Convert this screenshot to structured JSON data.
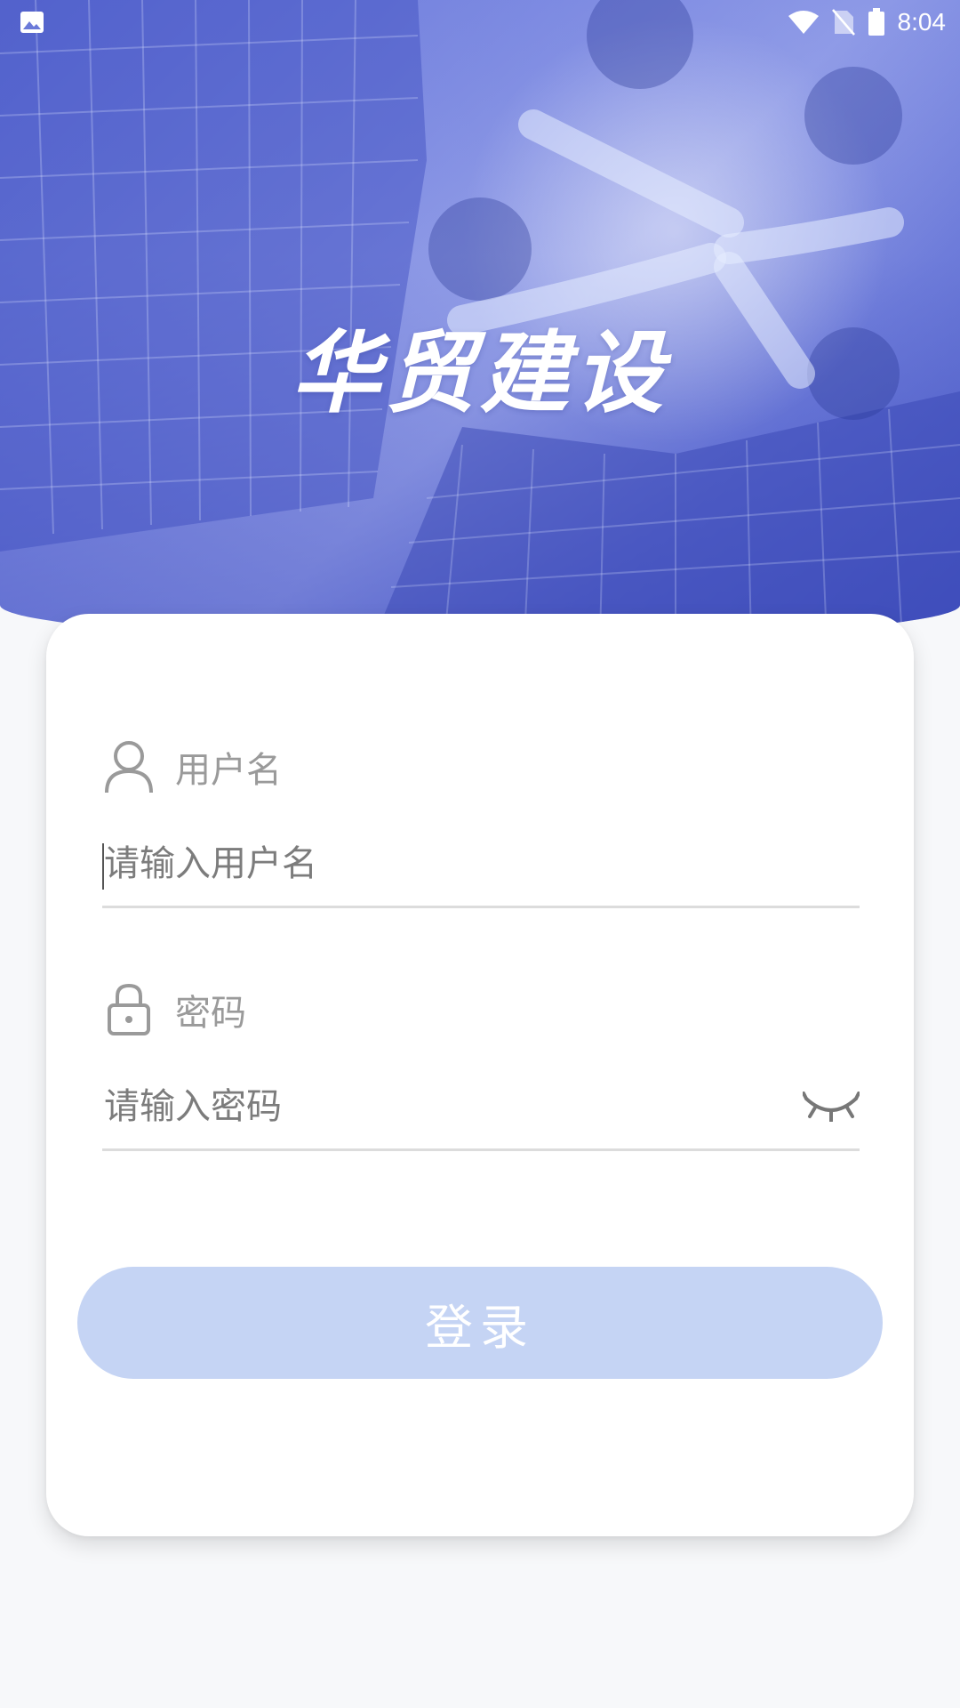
{
  "status_bar": {
    "time": "8:04",
    "left_icon": "image-icon",
    "right_icons": [
      "wifi-icon",
      "no-sim-icon",
      "battery-icon"
    ]
  },
  "hero": {
    "brand_title": "华贸建设",
    "theme_color": "#5c6cd6"
  },
  "form": {
    "username": {
      "label": "用户名",
      "icon": "user-icon",
      "placeholder": "请输入用户名",
      "value": ""
    },
    "password": {
      "label": "密码",
      "icon": "lock-icon",
      "placeholder": "请输入密码",
      "value": "",
      "toggle_icon": "eye-closed-icon"
    },
    "login_button": {
      "label": "登录",
      "color": "#c5d4f4"
    }
  }
}
